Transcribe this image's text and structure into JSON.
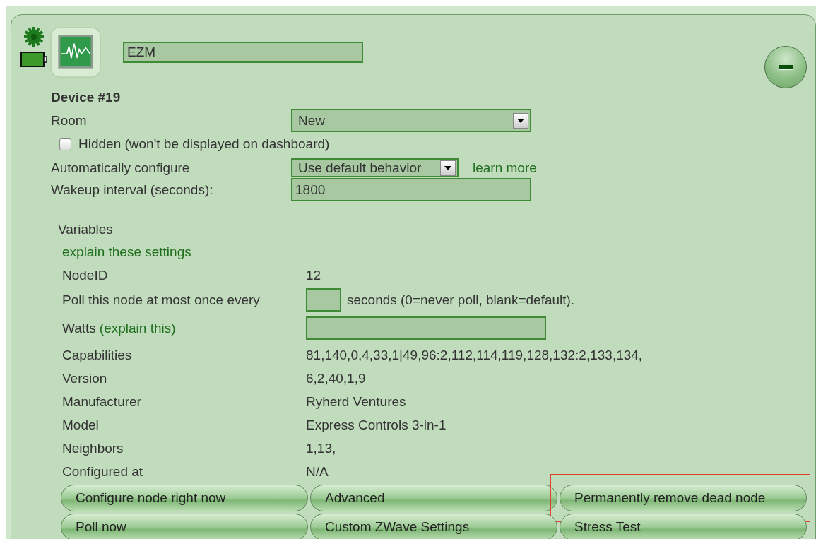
{
  "device": {
    "name": "EZM",
    "title": "Device #19"
  },
  "room": {
    "label": "Room",
    "value": "New"
  },
  "hidden": {
    "label": "Hidden (won't be displayed on dashboard)",
    "checked": false
  },
  "auto_configure": {
    "label": "Automatically configure",
    "value": "Use default behavior",
    "link": "learn more"
  },
  "wakeup": {
    "label": "Wakeup interval (seconds):",
    "value": "1800"
  },
  "variables": {
    "heading": "Variables",
    "explain_link": "explain these settings"
  },
  "rows": [
    {
      "kind": "text",
      "label": "NodeID",
      "value": "12"
    },
    {
      "kind": "poll",
      "label": "Poll this node at most once every",
      "note": "seconds (0=never poll, blank=default)."
    },
    {
      "kind": "input",
      "label": "Watts",
      "link": "(explain this)"
    },
    {
      "kind": "text",
      "label": "Capabilities",
      "value": "81,140,0,4,33,1|49,96:2,112,114,119,128,132:2,133,134,"
    },
    {
      "kind": "text",
      "label": "Version",
      "value": "6,2,40,1,9"
    },
    {
      "kind": "text",
      "label": "Manufacturer",
      "value": "Ryherd Ventures"
    },
    {
      "kind": "text",
      "label": "Model",
      "value": "Express Controls 3-in-1"
    },
    {
      "kind": "text",
      "label": "Neighbors",
      "value": "1,13,"
    },
    {
      "kind": "text",
      "label": "Configured at",
      "value": "N/A"
    }
  ],
  "buttons": [
    {
      "label": "Configure node right now",
      "highlighted": false
    },
    {
      "label": "Advanced",
      "highlighted": false
    },
    {
      "label": "Permanently remove dead node",
      "highlighted": true
    },
    {
      "label": "Poll now",
      "highlighted": false
    },
    {
      "label": "Custom ZWave Settings",
      "highlighted": false
    },
    {
      "label": "Stress Test",
      "highlighted": false
    }
  ]
}
